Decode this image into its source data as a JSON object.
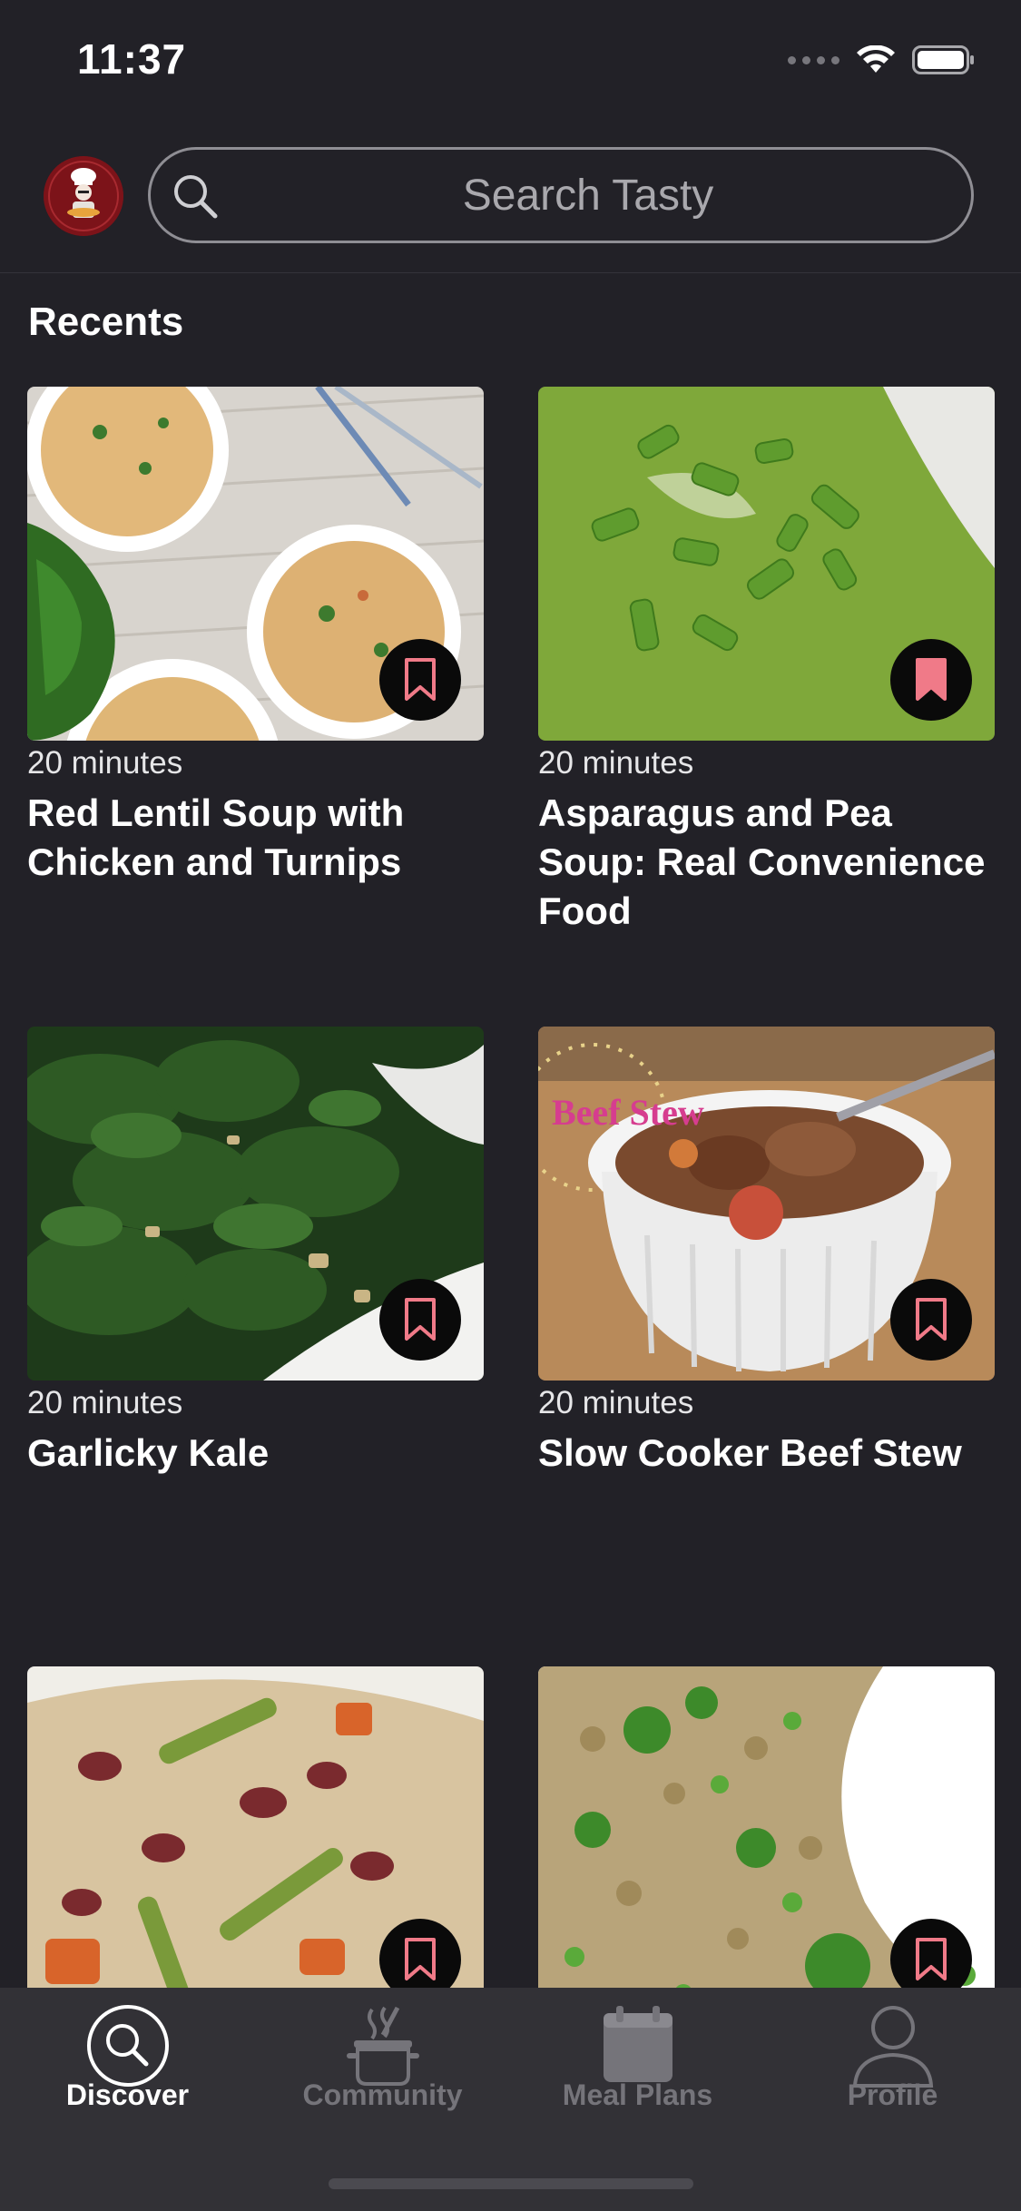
{
  "status": {
    "time": "11:37"
  },
  "search": {
    "placeholder": "Search Tasty"
  },
  "section": {
    "title": "Recents"
  },
  "recipes": [
    {
      "time": "20 minutes",
      "title": "Red Lentil Soup with Chicken and Turnips",
      "saved": false
    },
    {
      "time": "20 minutes",
      "title": "Asparagus and Pea Soup: Real Convenience Food",
      "saved": true
    },
    {
      "time": "20 minutes",
      "title": "Garlicky Kale",
      "saved": false
    },
    {
      "time": "20 minutes",
      "title": "Slow Cooker Beef Stew",
      "saved": false
    },
    {
      "time": "",
      "title": "",
      "saved": false
    },
    {
      "time": "",
      "title": "",
      "saved": false
    }
  ],
  "tabs": [
    {
      "label": "Discover",
      "icon": "search-icon",
      "active": true
    },
    {
      "label": "Community",
      "icon": "cooking-pot-icon",
      "active": false
    },
    {
      "label": "Meal Plans",
      "icon": "calendar-icon",
      "active": false
    },
    {
      "label": "Profile",
      "icon": "person-icon",
      "active": false
    }
  ],
  "colors": {
    "background": "#222127",
    "tabbar": "#323136",
    "saved_bookmark": "#f07a88",
    "brand": "#7c1319"
  }
}
